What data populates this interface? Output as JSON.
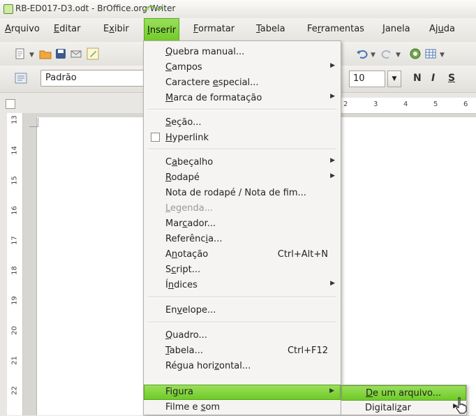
{
  "window": {
    "title": "RB-ED017-D3.odt - BrOffice.org Writer"
  },
  "menubar": {
    "items": [
      {
        "pre": "",
        "mnem": "A",
        "post": "rquivo"
      },
      {
        "pre": "",
        "mnem": "E",
        "post": "ditar"
      },
      {
        "pre": "E",
        "mnem": "x",
        "post": "ibir"
      },
      {
        "pre": "",
        "mnem": "I",
        "post": "nserir"
      },
      {
        "pre": "",
        "mnem": "F",
        "post": "ormatar"
      },
      {
        "pre": "",
        "mnem": "T",
        "post": "abela"
      },
      {
        "pre": "Fe",
        "mnem": "r",
        "post": "ramentas"
      },
      {
        "pre": "",
        "mnem": "J",
        "post": "anela"
      },
      {
        "pre": "Aj",
        "mnem": "u",
        "post": "da"
      }
    ]
  },
  "formatting": {
    "style": "Padrão",
    "font_size": "10",
    "bold": "N",
    "italic": "I",
    "underline": "S"
  },
  "ruler": {
    "h_labels": [
      "2",
      "3",
      "4",
      "5",
      "6"
    ],
    "v_labels": [
      "13",
      "14",
      "15",
      "16",
      "17",
      "18",
      "19",
      "20",
      "21",
      "22"
    ]
  },
  "insert_menu": {
    "items": [
      {
        "pre": "",
        "mnem": "Q",
        "post": "uebra manual...",
        "submenu": false
      },
      {
        "pre": "",
        "mnem": "C",
        "post": "ampos",
        "submenu": true
      },
      {
        "pre": "Caractere ",
        "mnem": "e",
        "post": "special...",
        "submenu": false
      },
      {
        "pre": "",
        "mnem": "M",
        "post": "arca de formatação",
        "submenu": true
      },
      {
        "pre": "",
        "mnem": "S",
        "post": "eção...",
        "submenu": false
      },
      {
        "pre": "",
        "mnem": "H",
        "post": "yperlink",
        "submenu": false
      },
      {
        "pre": "C",
        "mnem": "a",
        "post": "beçalho",
        "submenu": true
      },
      {
        "pre": "",
        "mnem": "R",
        "post": "odapé",
        "submenu": true
      },
      {
        "pre": "Nota de rodapé / Nota de fim",
        "mnem": "",
        "post": "...",
        "submenu": false
      },
      {
        "pre": "",
        "mnem": "L",
        "post": "egenda...",
        "submenu": false
      },
      {
        "pre": "Mar",
        "mnem": "c",
        "post": "ador...",
        "submenu": false
      },
      {
        "pre": "Referênc",
        "mnem": "i",
        "post": "a...",
        "submenu": false
      },
      {
        "pre": "A",
        "mnem": "n",
        "post": "otação",
        "submenu": false,
        "shortcut": "Ctrl+Alt+N"
      },
      {
        "pre": "S",
        "mnem": "c",
        "post": "ript...",
        "submenu": false
      },
      {
        "pre": "Í",
        "mnem": "n",
        "post": "dices",
        "submenu": true
      },
      {
        "pre": "En",
        "mnem": "v",
        "post": "elope...",
        "submenu": false
      },
      {
        "pre": "",
        "mnem": "Q",
        "post": "uadro...",
        "submenu": false
      },
      {
        "pre": "",
        "mnem": "T",
        "post": "abela...",
        "submenu": false,
        "shortcut": "Ctrl+F12"
      },
      {
        "pre": "Régua hori",
        "mnem": "z",
        "post": "ontal...",
        "submenu": false
      },
      {
        "pre": "Fi",
        "mnem": "g",
        "post": "ura",
        "submenu": true
      },
      {
        "pre": "Filme e ",
        "mnem": "s",
        "post": "om",
        "submenu": false
      }
    ]
  },
  "figure_submenu": {
    "items": [
      {
        "pre": "",
        "mnem": "D",
        "post": "e um arquivo..."
      },
      {
        "pre": "Digitali",
        "mnem": "z",
        "post": "ar"
      }
    ]
  },
  "colors": {
    "highlight": "#7ed43a",
    "menu_bg": "#f5f4f2"
  }
}
